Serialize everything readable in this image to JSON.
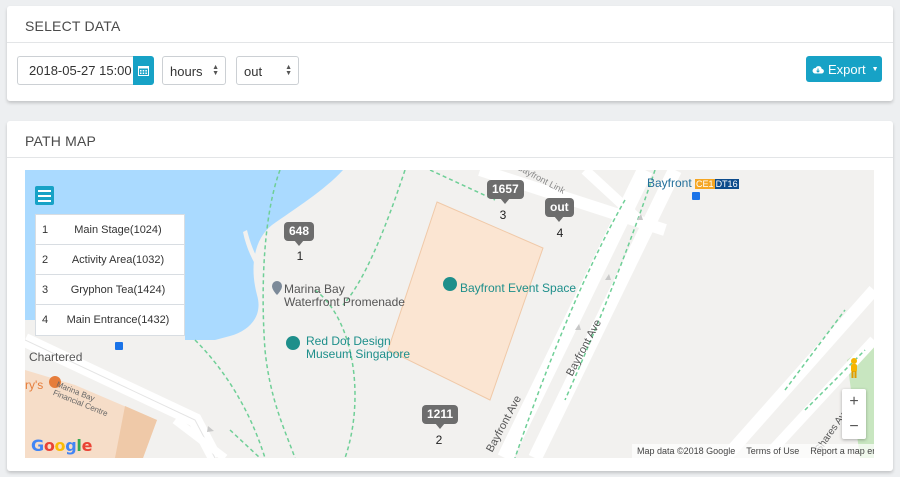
{
  "select_panel": {
    "title": "SELECT DATA",
    "date_value": "2018-05-27 15:00",
    "unit_select": "hours",
    "direction_select": "out",
    "export_label": "Export"
  },
  "path_panel": {
    "title": "PATH MAP"
  },
  "route_list": [
    {
      "index": "1",
      "name": "Main Stage(1024)"
    },
    {
      "index": "2",
      "name": "Activity Area(1032)"
    },
    {
      "index": "3",
      "name": "Gryphon Tea(1424)"
    },
    {
      "index": "4",
      "name": "Main Entrance(1432)"
    }
  ],
  "markers": [
    {
      "label": "648",
      "num": "1"
    },
    {
      "label": "1211",
      "num": "2"
    },
    {
      "label": "1657",
      "num": "3"
    },
    {
      "label": "out",
      "num": "4"
    }
  ],
  "map_labels": {
    "bayfront": "Bayfront",
    "station_ce": "CE1",
    "station_dt": "DT16",
    "event_space": "Bayfront Event Space",
    "promenade_1": "Marina Bay",
    "promenade_2": "Waterfront Promenade",
    "museum_1": "Red Dot Design",
    "museum_2": "Museum Singapore",
    "chartered": "Chartered",
    "rys": "ry's",
    "mbfc_1": "Marina Bay",
    "mbfc_2": "Financial Centre",
    "bayfront_ave_1": "Bayfront Ave",
    "bayfront_ave_2": "Bayfront Ave",
    "bayfront_link": "Bayfront Link",
    "shares_ave": "Shares Ave"
  },
  "attribution": {
    "map_data": "Map data ©2018 Google",
    "terms": "Terms of Use",
    "report": "Report a map error"
  },
  "zoom": {
    "in": "+",
    "out": "−"
  },
  "colors": {
    "accent": "#17a2c6",
    "water": "#aadaff",
    "marker": "#6d6d6d"
  }
}
